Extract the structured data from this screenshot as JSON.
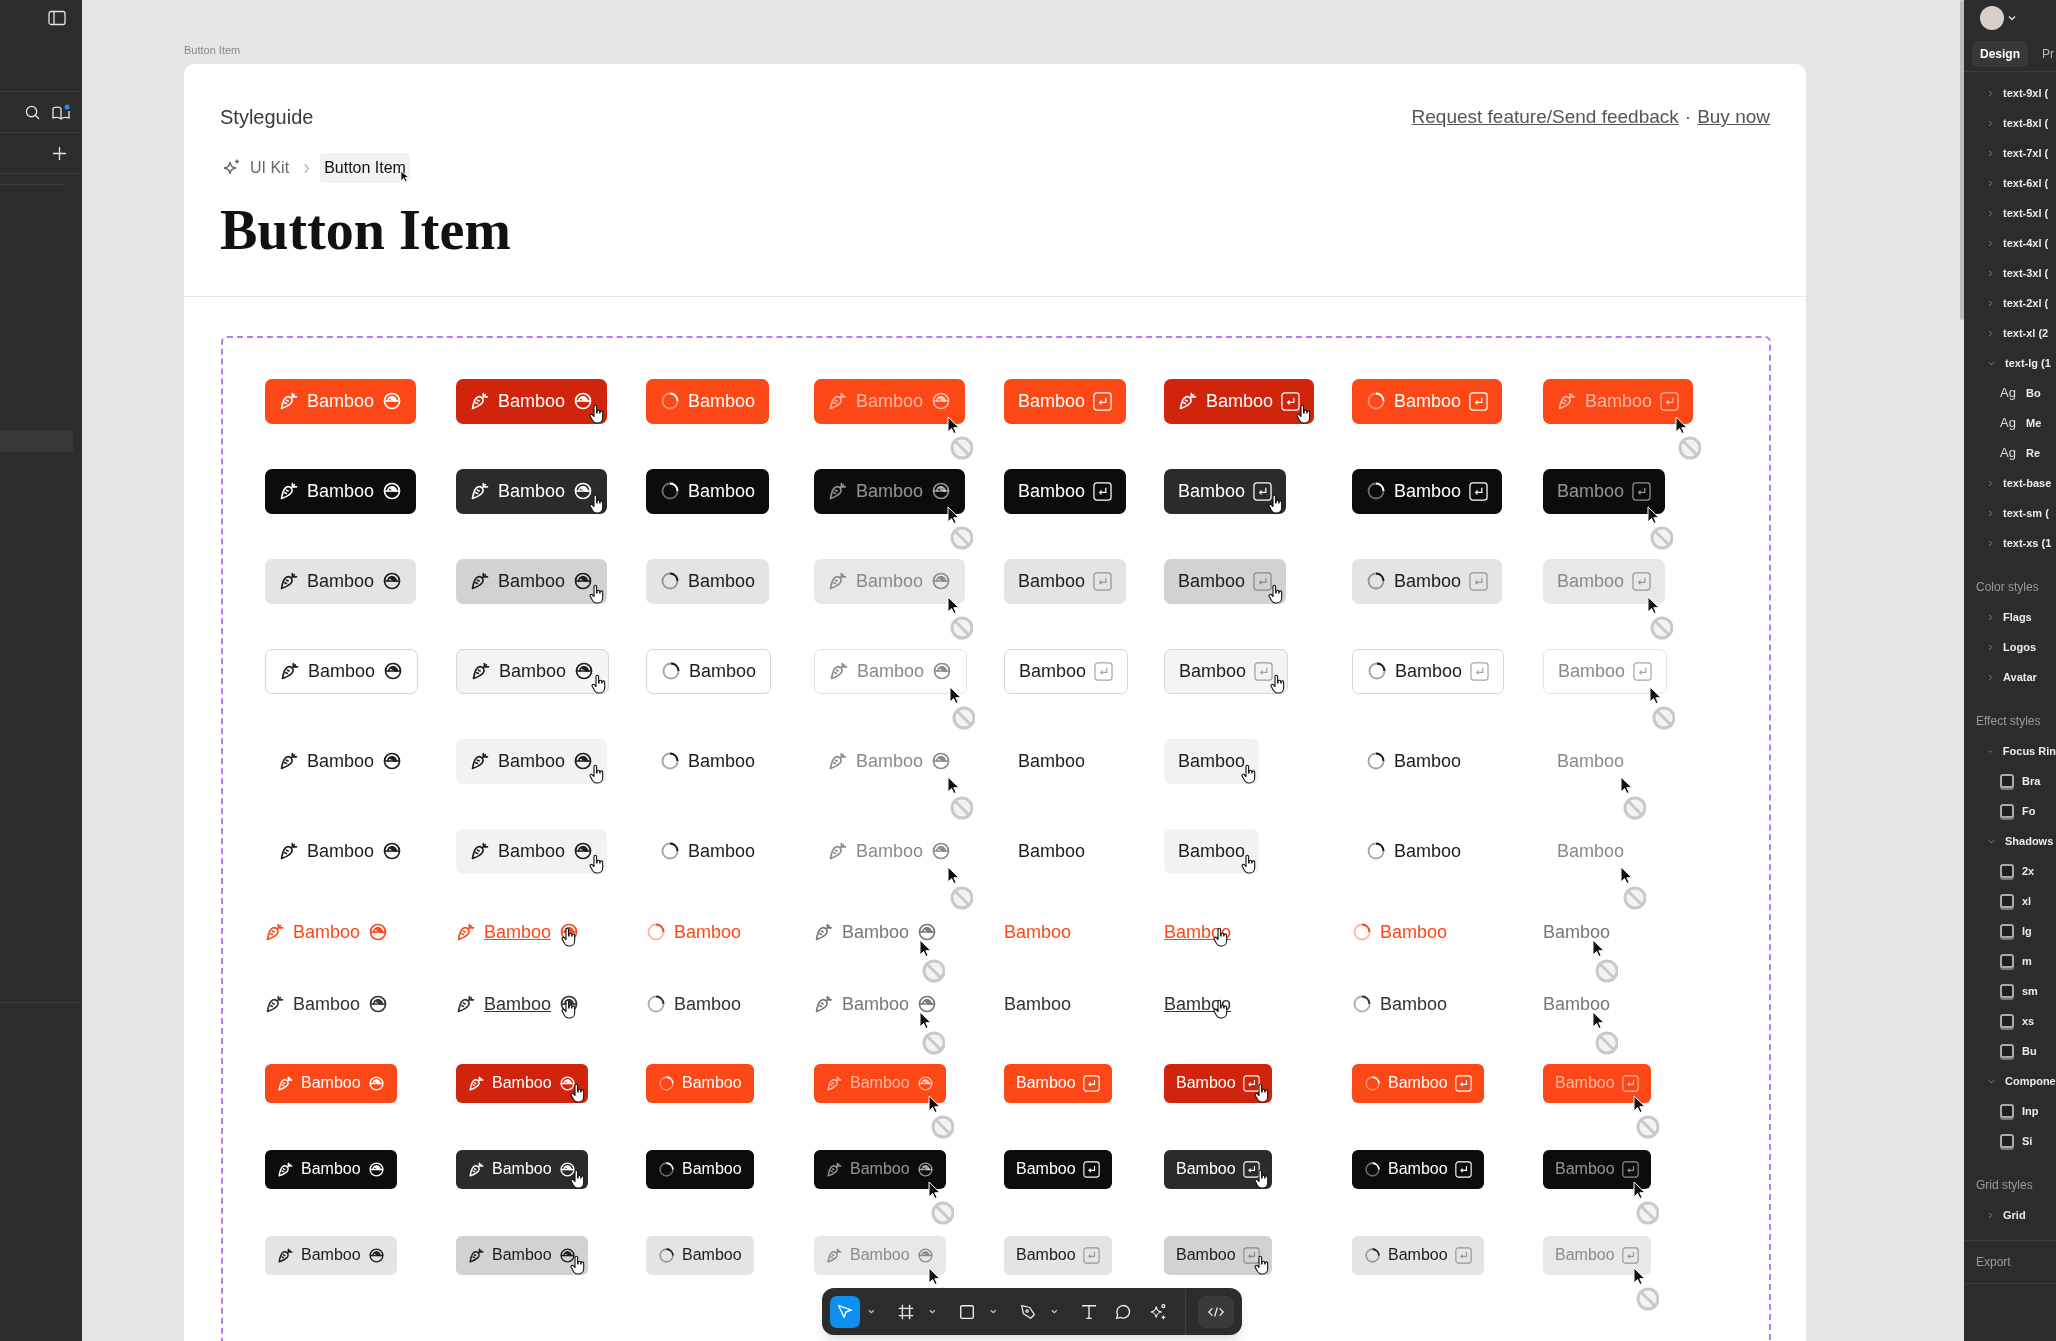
{
  "canvas": {
    "frame_label": "Button Item"
  },
  "header": {
    "title": "Styleguide",
    "links": [
      {
        "label": "Request feature/Send feedback"
      },
      {
        "label": "Buy now"
      }
    ],
    "separator": "·",
    "breadcrumb": [
      {
        "label": "UI Kit",
        "selected": false
      },
      {
        "label": "Button Item",
        "selected": true
      }
    ],
    "page_title": "Button Item"
  },
  "grid": {
    "rows": [
      {
        "kind": "primary",
        "buttons": [
          {
            "kind": "icons",
            "label": "Bamboo",
            "hovered": false,
            "disabled": false
          },
          {
            "kind": "icons",
            "label": "Bamboo",
            "hovered": true,
            "disabled": false
          },
          {
            "kind": "spinner",
            "label": "Bamboo",
            "hovered": false,
            "disabled": false
          },
          {
            "kind": "icons",
            "label": "Bamboo",
            "hovered": false,
            "disabled": true
          },
          {
            "kind": "shortcut",
            "label": "Bamboo",
            "hovered": false,
            "disabled": false
          },
          {
            "kind": "icon-shortcut",
            "label": "Bamboo",
            "hovered": true,
            "disabled": false
          },
          {
            "kind": "spinner-shortcut",
            "label": "Bamboo",
            "hovered": false,
            "disabled": false
          },
          {
            "kind": "icon-shortcut",
            "label": "Bamboo",
            "hovered": false,
            "disabled": true
          }
        ]
      },
      {
        "kind": "dark",
        "buttons": [
          {
            "kind": "icons",
            "label": "Bamboo",
            "hovered": false,
            "disabled": false
          },
          {
            "kind": "icons",
            "label": "Bamboo",
            "hovered": true,
            "disabled": false
          },
          {
            "kind": "spinner",
            "label": "Bamboo",
            "hovered": false,
            "disabled": false
          },
          {
            "kind": "icons",
            "label": "Bamboo",
            "hovered": false,
            "disabled": true
          },
          {
            "kind": "shortcut",
            "label": "Bamboo",
            "hovered": false,
            "disabled": false
          },
          {
            "kind": "shortcut",
            "label": "Bamboo",
            "hovered": true,
            "disabled": false
          },
          {
            "kind": "spinner-shortcut",
            "label": "Bamboo",
            "hovered": false,
            "disabled": false
          },
          {
            "kind": "shortcut",
            "label": "Bamboo",
            "hovered": false,
            "disabled": true
          }
        ]
      },
      {
        "kind": "gray",
        "buttons": [
          {
            "kind": "icons",
            "label": "Bamboo",
            "hovered": false,
            "disabled": false
          },
          {
            "kind": "icons",
            "label": "Bamboo",
            "hovered": true,
            "disabled": false
          },
          {
            "kind": "spinner",
            "label": "Bamboo",
            "hovered": false,
            "disabled": false
          },
          {
            "kind": "icons",
            "label": "Bamboo",
            "hovered": false,
            "disabled": true
          },
          {
            "kind": "shortcut",
            "label": "Bamboo",
            "hovered": false,
            "disabled": false
          },
          {
            "kind": "shortcut",
            "label": "Bamboo",
            "hovered": true,
            "disabled": false
          },
          {
            "kind": "spinner-shortcut",
            "label": "Bamboo",
            "hovered": false,
            "disabled": false
          },
          {
            "kind": "shortcut",
            "label": "Bamboo",
            "hovered": false,
            "disabled": true
          }
        ]
      },
      {
        "kind": "outline",
        "buttons": [
          {
            "kind": "icons",
            "label": "Bamboo",
            "hovered": false,
            "disabled": false
          },
          {
            "kind": "icons",
            "label": "Bamboo",
            "hovered": true,
            "disabled": false
          },
          {
            "kind": "spinner",
            "label": "Bamboo",
            "hovered": false,
            "disabled": false
          },
          {
            "kind": "icons",
            "label": "Bamboo",
            "hovered": false,
            "disabled": true
          },
          {
            "kind": "shortcut",
            "label": "Bamboo",
            "hovered": false,
            "disabled": false
          },
          {
            "kind": "shortcut",
            "label": "Bamboo",
            "hovered": true,
            "disabled": false
          },
          {
            "kind": "spinner-shortcut",
            "label": "Bamboo",
            "hovered": false,
            "disabled": false
          },
          {
            "kind": "shortcut",
            "label": "Bamboo",
            "hovered": false,
            "disabled": true
          }
        ]
      },
      {
        "kind": "ghost",
        "buttons": [
          {
            "kind": "icons",
            "label": "Bamboo",
            "hovered": false,
            "disabled": false
          },
          {
            "kind": "icons",
            "label": "Bamboo",
            "hovered": true,
            "disabled": false
          },
          {
            "kind": "spinner",
            "label": "Bamboo",
            "hovered": false,
            "disabled": false
          },
          {
            "kind": "icons",
            "label": "Bamboo",
            "hovered": false,
            "disabled": true
          },
          {
            "kind": "plain",
            "label": "Bamboo",
            "hovered": false,
            "disabled": false
          },
          {
            "kind": "plain",
            "label": "Bamboo",
            "hovered": true,
            "disabled": false
          },
          {
            "kind": "spinner",
            "label": "Bamboo",
            "hovered": false,
            "disabled": false
          },
          {
            "kind": "plain",
            "label": "Bamboo",
            "hovered": false,
            "disabled": true
          }
        ]
      },
      {
        "kind": "ghost",
        "buttons": [
          {
            "kind": "icons",
            "label": "Bamboo",
            "hovered": false,
            "disabled": false
          },
          {
            "kind": "icons",
            "label": "Bamboo",
            "hovered": true,
            "disabled": false
          },
          {
            "kind": "spinner",
            "label": "Bamboo",
            "hovered": false,
            "disabled": false
          },
          {
            "kind": "icons",
            "label": "Bamboo",
            "hovered": false,
            "disabled": true
          },
          {
            "kind": "plain",
            "label": "Bamboo",
            "hovered": false,
            "disabled": false
          },
          {
            "kind": "plain",
            "label": "Bamboo",
            "hovered": true,
            "disabled": false
          },
          {
            "kind": "spinner",
            "label": "Bamboo",
            "hovered": false,
            "disabled": false
          },
          {
            "kind": "plain",
            "label": "Bamboo",
            "hovered": false,
            "disabled": true
          }
        ]
      },
      {
        "kind": "link-primary",
        "buttons": [
          {
            "kind": "icons",
            "label": "Bamboo",
            "hovered": false,
            "disabled": false
          },
          {
            "kind": "icons",
            "label": "Bamboo",
            "hovered": true,
            "disabled": false
          },
          {
            "kind": "spinner",
            "label": "Bamboo",
            "hovered": false,
            "disabled": false
          },
          {
            "kind": "icons",
            "label": "Bamboo",
            "hovered": false,
            "disabled": true
          },
          {
            "kind": "plain",
            "label": "Bamboo",
            "hovered": false,
            "disabled": false
          },
          {
            "kind": "plain",
            "label": "Bamboo",
            "hovered": true,
            "disabled": false
          },
          {
            "kind": "spinner",
            "label": "Bamboo",
            "hovered": false,
            "disabled": false
          },
          {
            "kind": "plain",
            "label": "Bamboo",
            "hovered": false,
            "disabled": true
          }
        ]
      },
      {
        "kind": "link-gray",
        "buttons": [
          {
            "kind": "icons",
            "label": "Bamboo",
            "hovered": false,
            "disabled": false
          },
          {
            "kind": "icons",
            "label": "Bamboo",
            "hovered": true,
            "disabled": false
          },
          {
            "kind": "spinner",
            "label": "Bamboo",
            "hovered": false,
            "disabled": false
          },
          {
            "kind": "icons",
            "label": "Bamboo",
            "hovered": false,
            "disabled": true
          },
          {
            "kind": "plain",
            "label": "Bamboo",
            "hovered": false,
            "disabled": false
          },
          {
            "kind": "plain",
            "label": "Bamboo",
            "hovered": true,
            "disabled": false
          },
          {
            "kind": "spinner",
            "label": "Bamboo",
            "hovered": false,
            "disabled": false
          },
          {
            "kind": "plain",
            "label": "Bamboo",
            "hovered": false,
            "disabled": true
          }
        ]
      },
      {
        "kind": "primary-small",
        "buttons": [
          {
            "kind": "icons",
            "label": "Bamboo",
            "hovered": false,
            "disabled": false
          },
          {
            "kind": "icons",
            "label": "Bamboo",
            "hovered": true,
            "disabled": false
          },
          {
            "kind": "spinner",
            "label": "Bamboo",
            "hovered": false,
            "disabled": false
          },
          {
            "kind": "icons",
            "label": "Bamboo",
            "hovered": false,
            "disabled": true
          },
          {
            "kind": "shortcut",
            "label": "Bamboo",
            "hovered": false,
            "disabled": false
          },
          {
            "kind": "shortcut",
            "label": "Bamboo",
            "hovered": true,
            "disabled": false
          },
          {
            "kind": "spinner-shortcut",
            "label": "Bamboo",
            "hovered": false,
            "disabled": false
          },
          {
            "kind": "shortcut",
            "label": "Bamboo",
            "hovered": false,
            "disabled": true
          }
        ]
      },
      {
        "kind": "dark-small",
        "buttons": [
          {
            "kind": "icons",
            "label": "Bamboo",
            "hovered": false,
            "disabled": false
          },
          {
            "kind": "icons",
            "label": "Bamboo",
            "hovered": true,
            "disabled": false
          },
          {
            "kind": "spinner",
            "label": "Bamboo",
            "hovered": false,
            "disabled": false
          },
          {
            "kind": "icons",
            "label": "Bamboo",
            "hovered": false,
            "disabled": true
          },
          {
            "kind": "shortcut",
            "label": "Bamboo",
            "hovered": false,
            "disabled": false
          },
          {
            "kind": "shortcut",
            "label": "Bamboo",
            "hovered": true,
            "disabled": false
          },
          {
            "kind": "spinner-shortcut",
            "label": "Bamboo",
            "hovered": false,
            "disabled": false
          },
          {
            "kind": "shortcut",
            "label": "Bamboo",
            "hovered": false,
            "disabled": true
          }
        ]
      },
      {
        "kind": "gray-small",
        "buttons": [
          {
            "kind": "icons",
            "label": "Bamboo",
            "hovered": false,
            "disabled": false
          },
          {
            "kind": "icons",
            "label": "Bamboo",
            "hovered": true,
            "disabled": false
          },
          {
            "kind": "spinner",
            "label": "Bamboo",
            "hovered": false,
            "disabled": false
          },
          {
            "kind": "icons",
            "label": "Bamboo",
            "hovered": false,
            "disabled": true
          },
          {
            "kind": "shortcut",
            "label": "Bamboo",
            "hovered": false,
            "disabled": false
          },
          {
            "kind": "shortcut",
            "label": "Bamboo",
            "hovered": true,
            "disabled": false
          },
          {
            "kind": "spinner-shortcut",
            "label": "Bamboo",
            "hovered": false,
            "disabled": false
          },
          {
            "kind": "shortcut",
            "label": "Bamboo",
            "hovered": false,
            "disabled": true
          }
        ]
      }
    ]
  },
  "toolbar": {
    "tools": [
      {
        "kind": "move",
        "selected": true
      },
      {
        "kind": "frame",
        "selected": false
      },
      {
        "kind": "shape",
        "selected": false
      },
      {
        "kind": "pen",
        "selected": false
      },
      {
        "kind": "text",
        "selected": false
      },
      {
        "kind": "comment",
        "selected": false
      },
      {
        "kind": "ai",
        "selected": false
      },
      {
        "kind": "code",
        "selected": false
      }
    ]
  },
  "right_panel": {
    "tabs": [
      {
        "label": "Design",
        "selected": true
      },
      {
        "label": "Pr",
        "selected": false
      }
    ],
    "sections": [
      {
        "items": [
          {
            "label": "text-9xl (",
            "expanded": false
          },
          {
            "label": "text-8xl (",
            "expanded": false
          },
          {
            "label": "text-7xl (",
            "expanded": false
          },
          {
            "label": "text-6xl (",
            "expanded": false
          },
          {
            "label": "text-5xl (",
            "expanded": false
          },
          {
            "label": "text-4xl (",
            "expanded": false
          },
          {
            "label": "text-3xl (",
            "expanded": false
          },
          {
            "label": "text-2xl (",
            "expanded": false
          },
          {
            "label": "text-xl (2",
            "expanded": false
          },
          {
            "label": "text-lg (1",
            "expanded": true,
            "children": [
              {
                "kind": "text-style",
                "preview": "Ag",
                "label": "Bo"
              },
              {
                "kind": "text-style",
                "preview": "Ag",
                "label": "Me"
              },
              {
                "kind": "text-style",
                "preview": "Ag",
                "label": "Re"
              }
            ]
          },
          {
            "label": "text-base",
            "expanded": false
          },
          {
            "label": "text-sm (",
            "expanded": false
          },
          {
            "label": "text-xs (1",
            "expanded": false
          }
        ]
      },
      {
        "heading": "Color styles",
        "items": [
          {
            "label": "Flags",
            "expanded": false
          },
          {
            "label": "Logos",
            "expanded": false
          },
          {
            "label": "Avatar",
            "expanded": false
          }
        ]
      },
      {
        "heading": "Effect styles",
        "items": [
          {
            "label": "Focus Rin",
            "expanded": true,
            "children": [
              {
                "kind": "effect",
                "label": "Bra"
              },
              {
                "kind": "effect",
                "label": "Fo"
              }
            ]
          },
          {
            "label": "Shadows",
            "expanded": true,
            "children": [
              {
                "kind": "effect",
                "label": "2x"
              },
              {
                "kind": "effect",
                "label": "xl"
              },
              {
                "kind": "effect",
                "label": "lg"
              },
              {
                "kind": "effect",
                "label": "m"
              },
              {
                "kind": "effect",
                "label": "sm"
              },
              {
                "kind": "effect",
                "label": "xs"
              },
              {
                "kind": "effect",
                "label": "Bu"
              }
            ]
          },
          {
            "label": "Compone",
            "expanded": true,
            "children": [
              {
                "kind": "effect",
                "label": "Inp"
              },
              {
                "kind": "effect",
                "label": "Si"
              }
            ]
          }
        ]
      },
      {
        "heading": "Grid styles",
        "items": [
          {
            "label": "Grid",
            "expanded": false
          }
        ]
      },
      {
        "heading": "Export"
      }
    ]
  }
}
